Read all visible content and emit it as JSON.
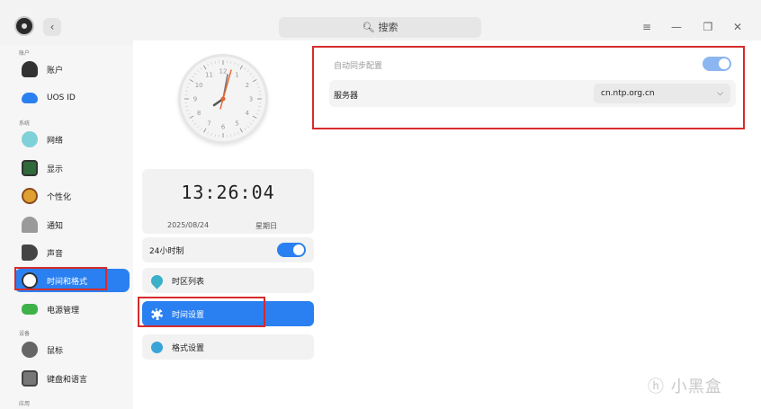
{
  "window": {
    "search_icon": "search-icon",
    "search_label": "搜索",
    "back_glyph": "‹",
    "menu_glyph": "≡",
    "minimize_glyph": "—",
    "restore_glyph": "❐",
    "close_glyph": "✕"
  },
  "sidebar": {
    "sections": {
      "account": "账户",
      "system": "系统",
      "device": "设备",
      "apps": "应用"
    },
    "items": [
      {
        "label": "账户",
        "icon": "user-icon",
        "color": "#333333"
      },
      {
        "label": "UOS ID",
        "icon": "cloud-icon",
        "color": "#2a80f0"
      },
      {
        "label": "网络",
        "icon": "globe-icon",
        "color": "#4fb8c9"
      },
      {
        "label": "显示",
        "icon": "monitor-icon",
        "color": "#2f6a3a"
      },
      {
        "label": "个性化",
        "icon": "palette-icon",
        "color": "#e0a030"
      },
      {
        "label": "通知",
        "icon": "bell-icon",
        "color": "#888888"
      },
      {
        "label": "声音",
        "icon": "speaker-icon",
        "color": "#444444"
      },
      {
        "label": "时间和格式",
        "icon": "clock-icon",
        "color": "#ffffff"
      },
      {
        "label": "电源管理",
        "icon": "battery-icon",
        "color": "#3fb14a"
      },
      {
        "label": "鼠标",
        "icon": "mouse-icon",
        "color": "#555555"
      },
      {
        "label": "键盘和语言",
        "icon": "keyboard-icon",
        "color": "#666666"
      }
    ]
  },
  "clock": {
    "time": "13:26:04",
    "date": "2025/08/24",
    "weekday": "星期日",
    "numbers": [
      "12",
      "1",
      "2",
      "3",
      "4",
      "5",
      "6",
      "7",
      "8",
      "9",
      "10",
      "11"
    ]
  },
  "middle": {
    "hour24_label": "24小时制",
    "hour24_on": true,
    "rows": [
      {
        "label": "时区列表",
        "icon": "location-pin-icon"
      },
      {
        "label": "时间设置",
        "icon": "gear-icon"
      },
      {
        "label": "格式设置",
        "icon": "format-icon"
      }
    ]
  },
  "right": {
    "auto_sync_label": "自动同步配置",
    "auto_sync_on": true,
    "server_label": "服务器",
    "server_value": "cn.ntp.org.cn"
  },
  "watermark": "小黑盒",
  "colors": {
    "accent": "#2a80f0",
    "highlight": "#d62b2b"
  }
}
